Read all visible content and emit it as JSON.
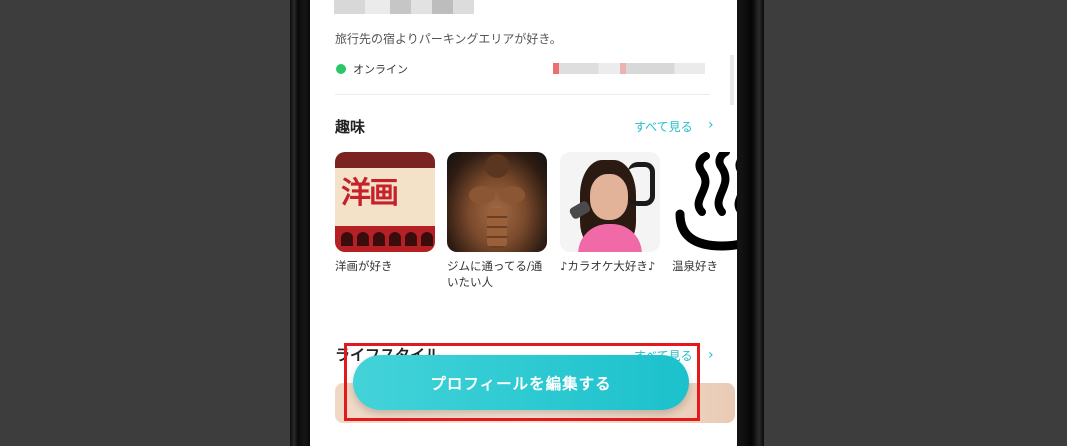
{
  "profile": {
    "bio": "旅行先の宿よりパーキングエリアが好き。",
    "online_status": "オンライン",
    "online_color": "#2cc56a"
  },
  "hobbies": {
    "title": "趣味",
    "see_all": "すべて見る",
    "items": [
      {
        "label": "洋画が好き",
        "image_text": "洋画"
      },
      {
        "label": "ジムに通ってる/通いたい人"
      },
      {
        "label": "♪カラオケ大好き♪"
      },
      {
        "label": "温泉好き"
      }
    ]
  },
  "lifestyle": {
    "title": "ライフスタイル",
    "see_all": "すべて見る"
  },
  "edit_button": {
    "label": "プロフィールを編集する",
    "color": "#1bc1cc"
  },
  "highlight_color": "#e3191c",
  "accent_color": "#23bfc8"
}
